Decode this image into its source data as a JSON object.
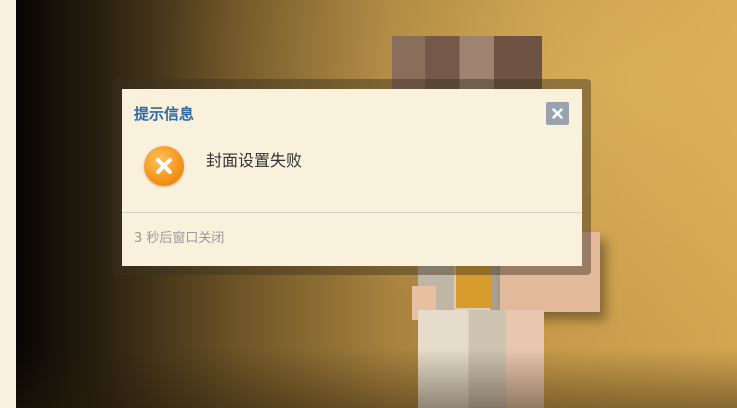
{
  "dialog": {
    "title": "提示信息",
    "message": "封面设置失败",
    "footer_note": "3 秒后窗口关闭",
    "close_icon": "close-icon",
    "status_icon": "error-x-icon"
  },
  "colors": {
    "title": "#2f6aa5",
    "dialog_bg": "#f9f1dc",
    "close_button": "#9aa3ad",
    "error_icon": "#f28b12"
  }
}
